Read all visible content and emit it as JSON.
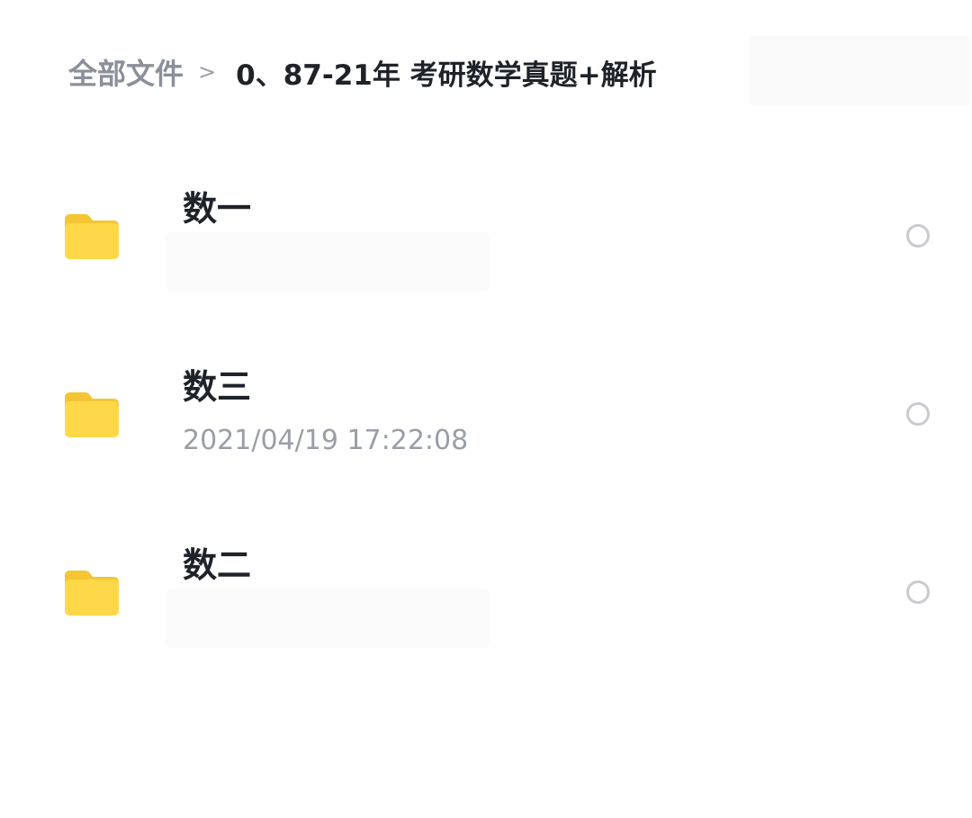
{
  "breadcrumb": {
    "root_label": "全部文件",
    "separator": ">",
    "current_label": "0、87-21年 考研数学真题+解析"
  },
  "colors": {
    "folder_yellow": "#FFD84A",
    "folder_tab": "#F5C634",
    "text_primary": "#1F2329",
    "text_secondary": "#9A9EA6",
    "radio_border": "#C9CBCF"
  },
  "files": [
    {
      "icon": "folder-icon",
      "name": "数一",
      "meta": ""
    },
    {
      "icon": "folder-icon",
      "name": "数三",
      "meta": "2021/04/19 17:22:08"
    },
    {
      "icon": "folder-icon",
      "name": "数二",
      "meta": ""
    }
  ]
}
